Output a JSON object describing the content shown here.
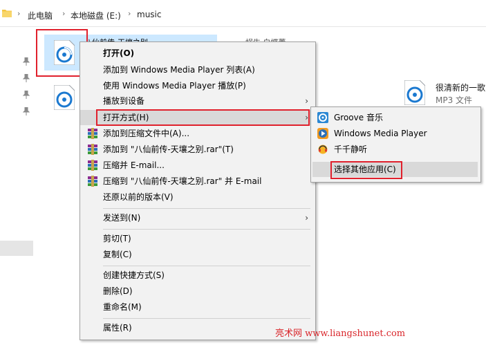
{
  "address": {
    "crumbs": [
      "此电脑",
      "本地磁盘 (E:)",
      "music"
    ]
  },
  "files": {
    "selected_name": "八仙前传-天壤之别",
    "behind_name": "蜗牛 白蝶蕾",
    "mp3_name": "很清新的一歌",
    "mp3_type": "MP3 文件"
  },
  "menu": {
    "open": "打开(O)",
    "add_to_wmp_list": "添加到 Windows Media Player 列表(A)",
    "play_with_wmp": "使用 Windows Media Player 播放(P)",
    "cast_to_device": "播放到设备",
    "open_with": "打开方式(H)",
    "add_to_archive": "添加到压缩文件中(A)...",
    "add_to_rar": "添加到 \"八仙前传-天壤之别.rar\"(T)",
    "compress_email": "压缩并 E-mail...",
    "compress_rar_email": "压缩到 \"八仙前传-天壤之别.rar\" 并 E-mail",
    "restore_versions": "还原以前的版本(V)",
    "send_to": "发送到(N)",
    "cut": "剪切(T)",
    "copy": "复制(C)",
    "create_shortcut": "创建快捷方式(S)",
    "delete": "删除(D)",
    "rename": "重命名(M)",
    "properties": "属性(R)"
  },
  "submenu": {
    "groove": "Groove 音乐",
    "wmp": "Windows Media Player",
    "ttplayer": "千千静听",
    "choose_other": "选择其他应用(C)"
  },
  "watermark": "亮术网 www.liangshunet.com",
  "colors": {
    "selection": "#cce8ff",
    "highlight_box": "#e0202c",
    "menu_bg": "#f2f2f2",
    "menu_hover": "#d9d9d9",
    "watermark": "#d9252a"
  }
}
